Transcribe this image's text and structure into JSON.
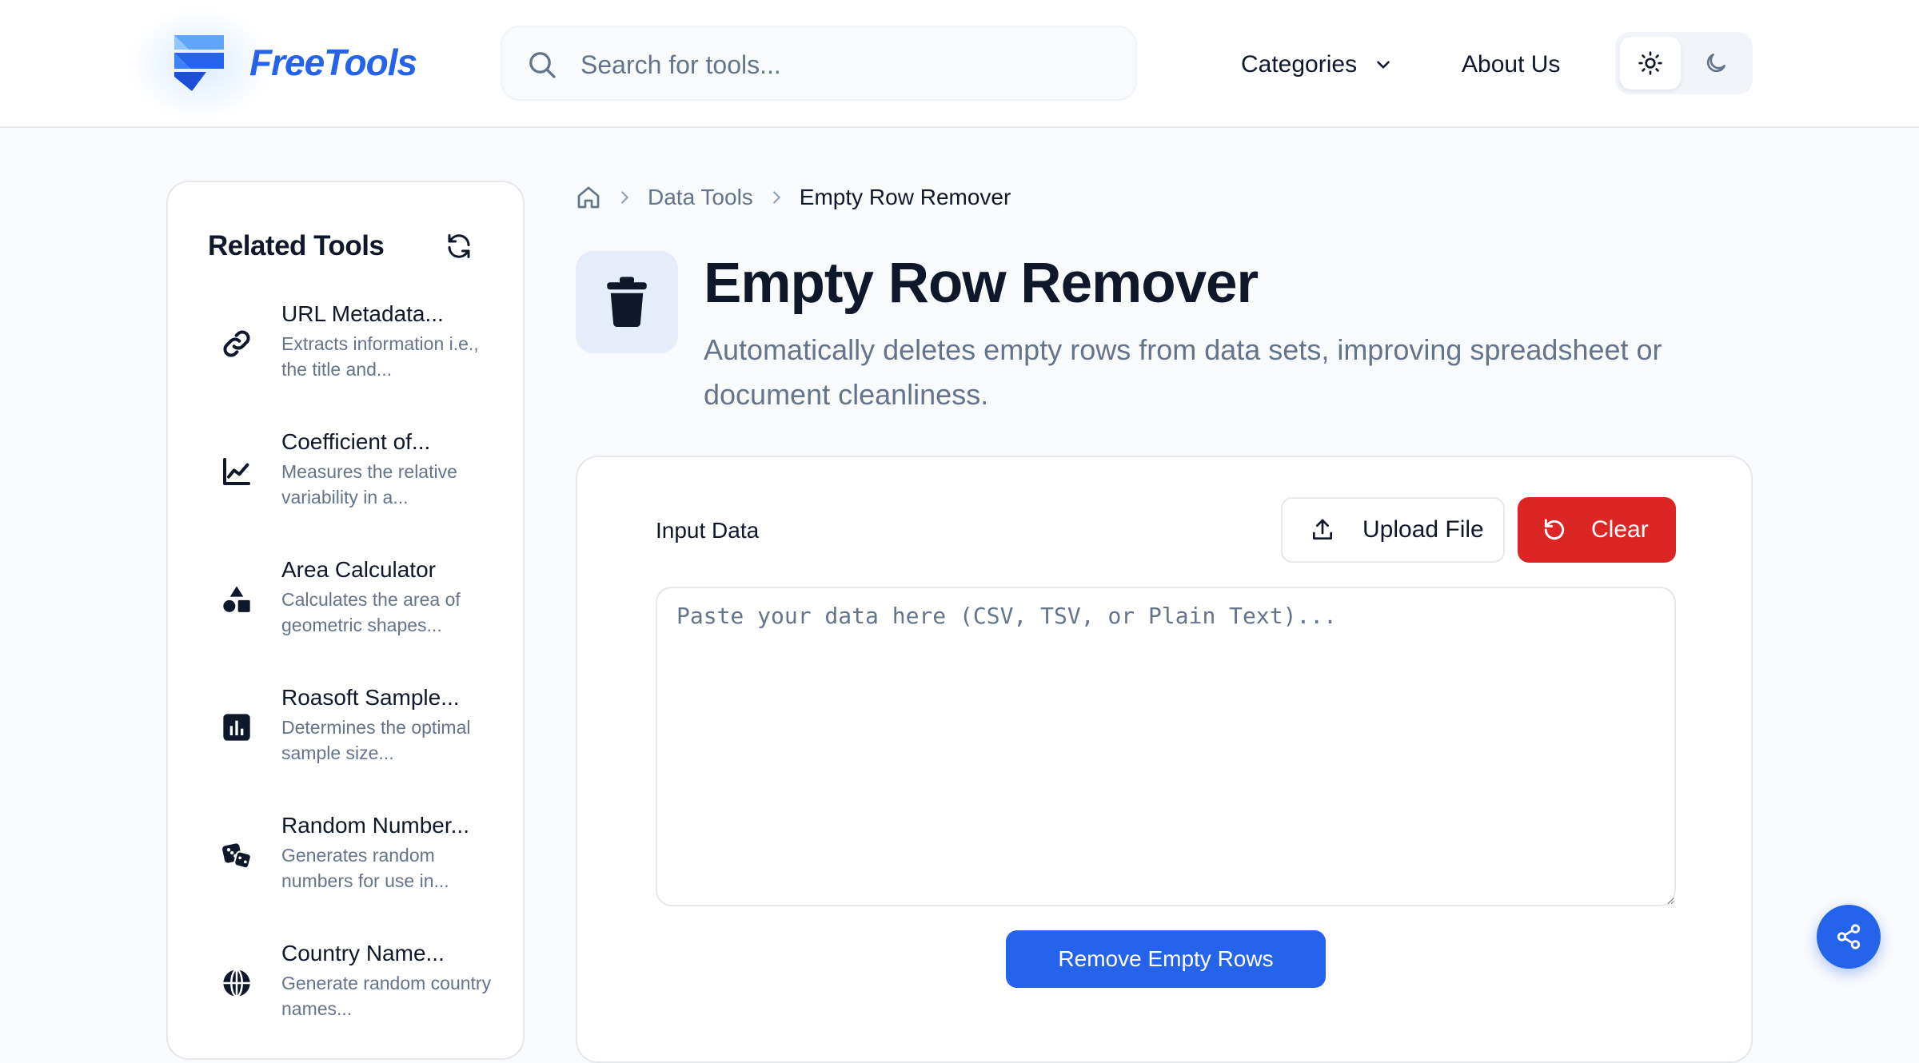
{
  "brand": {
    "name": "FreeTools",
    "color": "#2563eb"
  },
  "search": {
    "placeholder": "Search for tools..."
  },
  "nav": {
    "categories": "Categories",
    "about": "About Us"
  },
  "theme": {
    "options": [
      "light",
      "dark"
    ],
    "selected": "light"
  },
  "sidebar": {
    "title": "Related Tools",
    "items": [
      {
        "name": "URL Metadata...",
        "desc": "Extracts information i.e., the title and...",
        "icon": "link-icon"
      },
      {
        "name": "Coefficient of...",
        "desc": "Measures the relative variability in a...",
        "icon": "line-chart-icon"
      },
      {
        "name": "Area Calculator",
        "desc": "Calculates the area of geometric shapes...",
        "icon": "shapes-icon"
      },
      {
        "name": "Roasoft Sample...",
        "desc": "Determines the optimal sample size...",
        "icon": "bar-chart-icon"
      },
      {
        "name": "Random Number...",
        "desc": "Generates random numbers for use in...",
        "icon": "dice-icon"
      },
      {
        "name": "Country Name...",
        "desc": "Generate random country names...",
        "icon": "globe-icon"
      }
    ]
  },
  "breadcrumb": {
    "home_icon": "home-icon",
    "section": "Data Tools",
    "current": "Empty Row Remover"
  },
  "tool": {
    "icon": "trash-icon",
    "title": "Empty Row Remover",
    "description": "Automatically deletes empty rows from data sets, improving spreadsheet or document cleanliness."
  },
  "editor": {
    "label": "Input Data",
    "upload_label": "Upload File",
    "clear_label": "Clear",
    "clear_color": "#dc2626",
    "placeholder": "Paste your data here (CSV, TSV, or Plain Text)...",
    "value": "",
    "submit_label": "Remove Empty Rows"
  },
  "share": {
    "icon": "share-icon"
  }
}
